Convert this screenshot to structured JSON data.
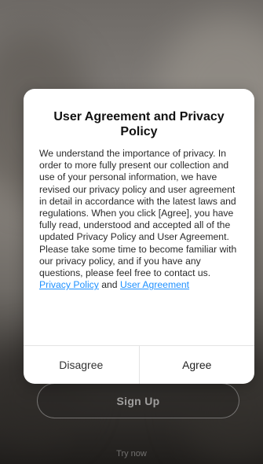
{
  "background": {
    "signup_label": "Sign Up",
    "trynow_label": "Try now"
  },
  "dialog": {
    "title": "User Agreement and Privacy Policy",
    "body": "We understand the importance of privacy. In order to more fully present our collection and use of your personal information, we have revised our privacy policy and user agreement in detail in accordance with the latest laws and regulations. When you click [Agree], you have fully read, understood and accepted all of the updated Privacy Policy and User Agreement. Please take some time to become familiar with our privacy policy, and if you have any questions, please feel free to contact us.",
    "privacy_link": "Privacy Policy",
    "and_text": "and",
    "agreement_link": "User Agreement",
    "disagree_label": "Disagree",
    "agree_label": "Agree"
  },
  "colors": {
    "link": "#1e90ff",
    "dialog_bg": "#ffffff"
  }
}
